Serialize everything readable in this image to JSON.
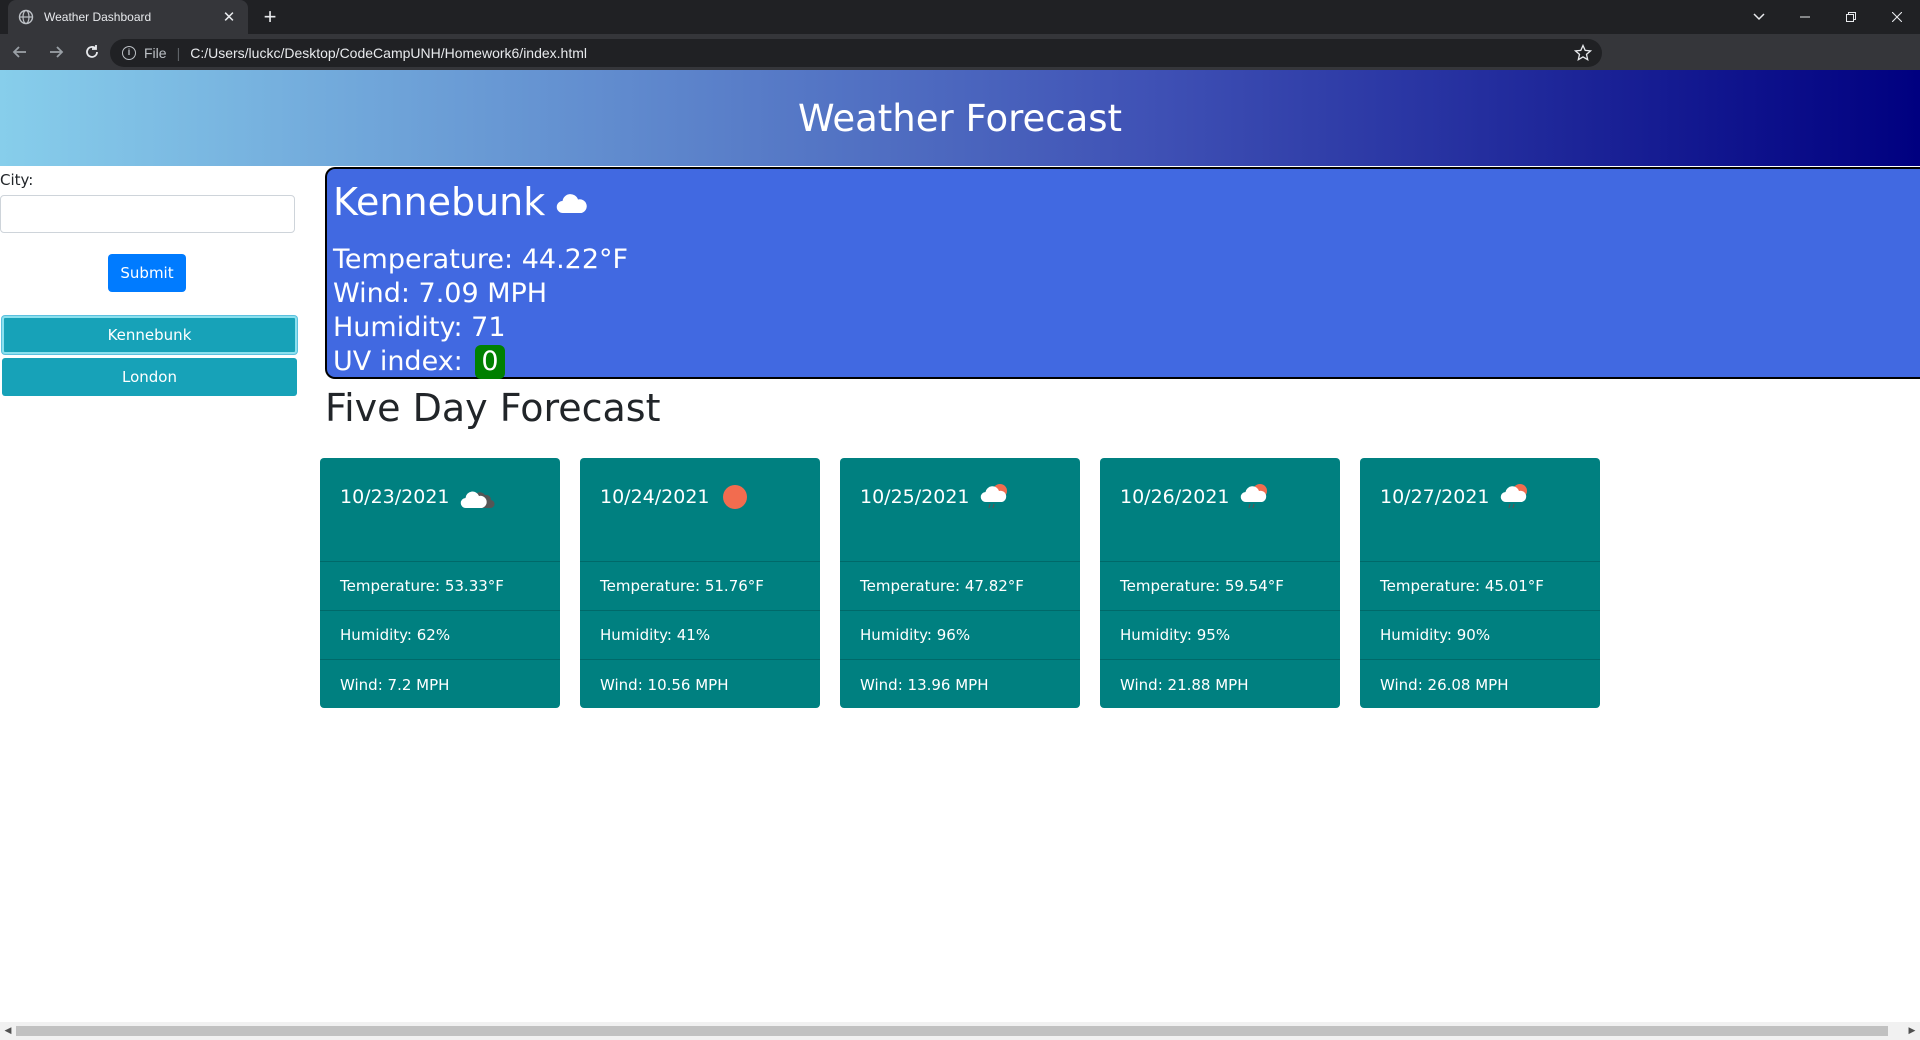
{
  "browser": {
    "tab_title": "Weather Dashboard",
    "omnibox_scheme": "File",
    "url": "C:/Users/luckc/Desktop/CodeCampUNH/Homework6/index.html"
  },
  "header": {
    "title": "Weather Forecast"
  },
  "search": {
    "label": "City:",
    "value": "",
    "submit_label": "Submit"
  },
  "history": [
    "Kennebunk",
    "London"
  ],
  "current": {
    "city": "Kennebunk",
    "icon": "cloud-icon",
    "temperature": "Temperature: 44.22°F",
    "wind": "Wind: 7.09 MPH",
    "humidity": "Humidity: 71",
    "uv_label": "UV index:",
    "uv_value": "0",
    "uv_color": "#008000"
  },
  "forecast": {
    "title": "Five Day Forecast",
    "days": [
      {
        "date": "10/23/2021",
        "icon": "cloudy-icon",
        "temp": "Temperature: 53.33°F",
        "humidity": "Humidity: 62%",
        "wind": "Wind: 7.2 MPH"
      },
      {
        "date": "10/24/2021",
        "icon": "sun-icon",
        "temp": "Temperature: 51.76°F",
        "humidity": "Humidity: 41%",
        "wind": "Wind: 10.56 MPH"
      },
      {
        "date": "10/25/2021",
        "icon": "rain-sun-icon",
        "temp": "Temperature: 47.82°F",
        "humidity": "Humidity: 96%",
        "wind": "Wind: 13.96 MPH"
      },
      {
        "date": "10/26/2021",
        "icon": "rain-sun-icon",
        "temp": "Temperature: 59.54°F",
        "humidity": "Humidity: 95%",
        "wind": "Wind: 21.88 MPH"
      },
      {
        "date": "10/27/2021",
        "icon": "rain-sun-icon",
        "temp": "Temperature: 45.01°F",
        "humidity": "Humidity: 90%",
        "wind": "Wind: 26.08 MPH"
      }
    ]
  },
  "colors": {
    "card": "#008080",
    "current_panel": "#4169e1",
    "history_button": "#17a2b8",
    "submit_button": "#007bff"
  }
}
